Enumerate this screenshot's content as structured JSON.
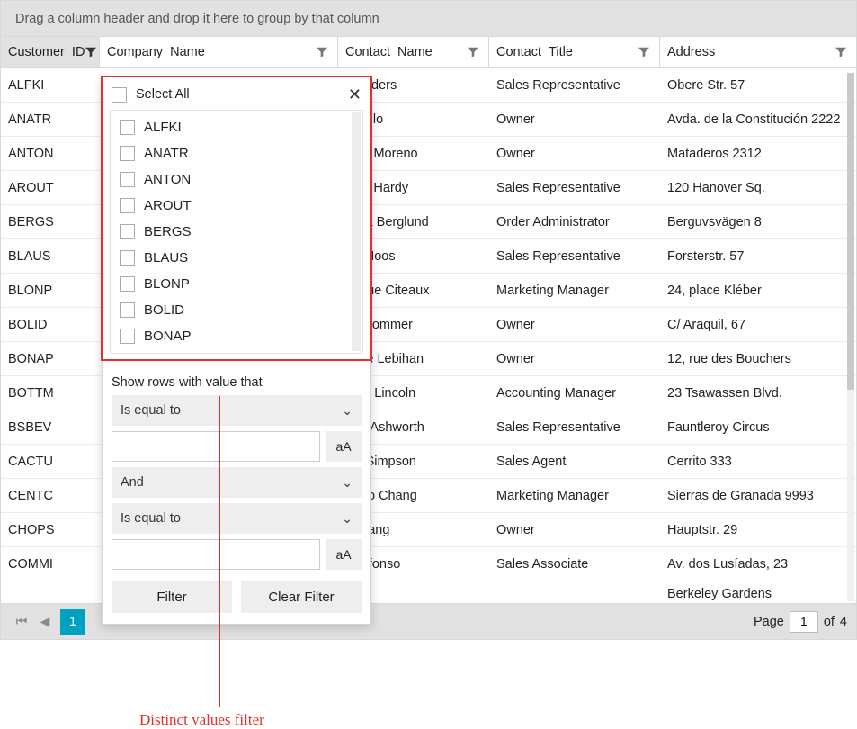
{
  "group_panel_text": "Drag a column header and drop it here to group by that column",
  "columns": {
    "customer_id": "Customer_ID",
    "company_name": "Company_Name",
    "contact_name": "Contact_Name",
    "contact_title": "Contact_Title",
    "address": "Address"
  },
  "rows": [
    {
      "id": "ALFKI",
      "contact": "a Anders",
      "title": "Sales Representative",
      "addr": "Obere Str. 57"
    },
    {
      "id": "ANATR",
      "contact": "Trujillo",
      "title": "Owner",
      "addr": "Avda. de la Constitución 2222"
    },
    {
      "id": "ANTON",
      "contact": "onio Moreno",
      "title": "Owner",
      "addr": "Mataderos  2312"
    },
    {
      "id": "AROUT",
      "contact": "mas Hardy",
      "title": "Sales Representative",
      "addr": "120 Hanover Sq."
    },
    {
      "id": "BERGS",
      "contact": "stina Berglund",
      "title": "Order Administrator",
      "addr": "Berguvsvägen  8"
    },
    {
      "id": "BLAUS",
      "contact": "na Moos",
      "title": "Sales Representative",
      "addr": "Forsterstr. 57"
    },
    {
      "id": "BLONP",
      "contact": "érique Citeaux",
      "title": "Marketing Manager",
      "addr": "24, place Kléber"
    },
    {
      "id": "BOLID",
      "contact": "tín Sommer",
      "title": "Owner",
      "addr": "C/ Araquil, 67"
    },
    {
      "id": "BONAP",
      "contact": "ence Lebihan",
      "title": "Owner",
      "addr": "12, rue des Bouchers"
    },
    {
      "id": "BOTTM",
      "contact": "beth Lincoln",
      "title": "Accounting Manager",
      "addr": "23 Tsawassen Blvd."
    },
    {
      "id": "BSBEV",
      "contact": "oria Ashworth",
      "title": "Sales Representative",
      "addr": "Fauntleroy Circus"
    },
    {
      "id": "CACTU",
      "contact": "cio Simpson",
      "title": "Sales Agent",
      "addr": "Cerrito 333"
    },
    {
      "id": "CENTC",
      "contact": "cisco Chang",
      "title": "Marketing Manager",
      "addr": "Sierras de Granada 9993"
    },
    {
      "id": "CHOPS",
      "contact": "g Wang",
      "title": "Owner",
      "addr": "Hauptstr. 29"
    },
    {
      "id": "COMMI",
      "contact": "ro Afonso",
      "title": "Sales Associate",
      "addr": "Av. dos Lusíadas, 23"
    }
  ],
  "last_row_addr": "Berkeley Gardens",
  "filter_popup": {
    "select_all_label": "Select All",
    "values": [
      "ALFKI",
      "ANATR",
      "ANTON",
      "AROUT",
      "BERGS",
      "BLAUS",
      "BLONP",
      "BOLID",
      "BONAP"
    ],
    "condition_label": "Show rows with value that",
    "operator1": "Is equal to",
    "logic": "And",
    "operator2": "Is equal to",
    "case_label": "aA",
    "filter_btn": "Filter",
    "clear_btn": "Clear Filter"
  },
  "pager": {
    "current_page": "1",
    "page_label": "Page",
    "page_input": "1",
    "of_label": "of",
    "total_pages": "4"
  },
  "annotation": "Distinct values filter"
}
